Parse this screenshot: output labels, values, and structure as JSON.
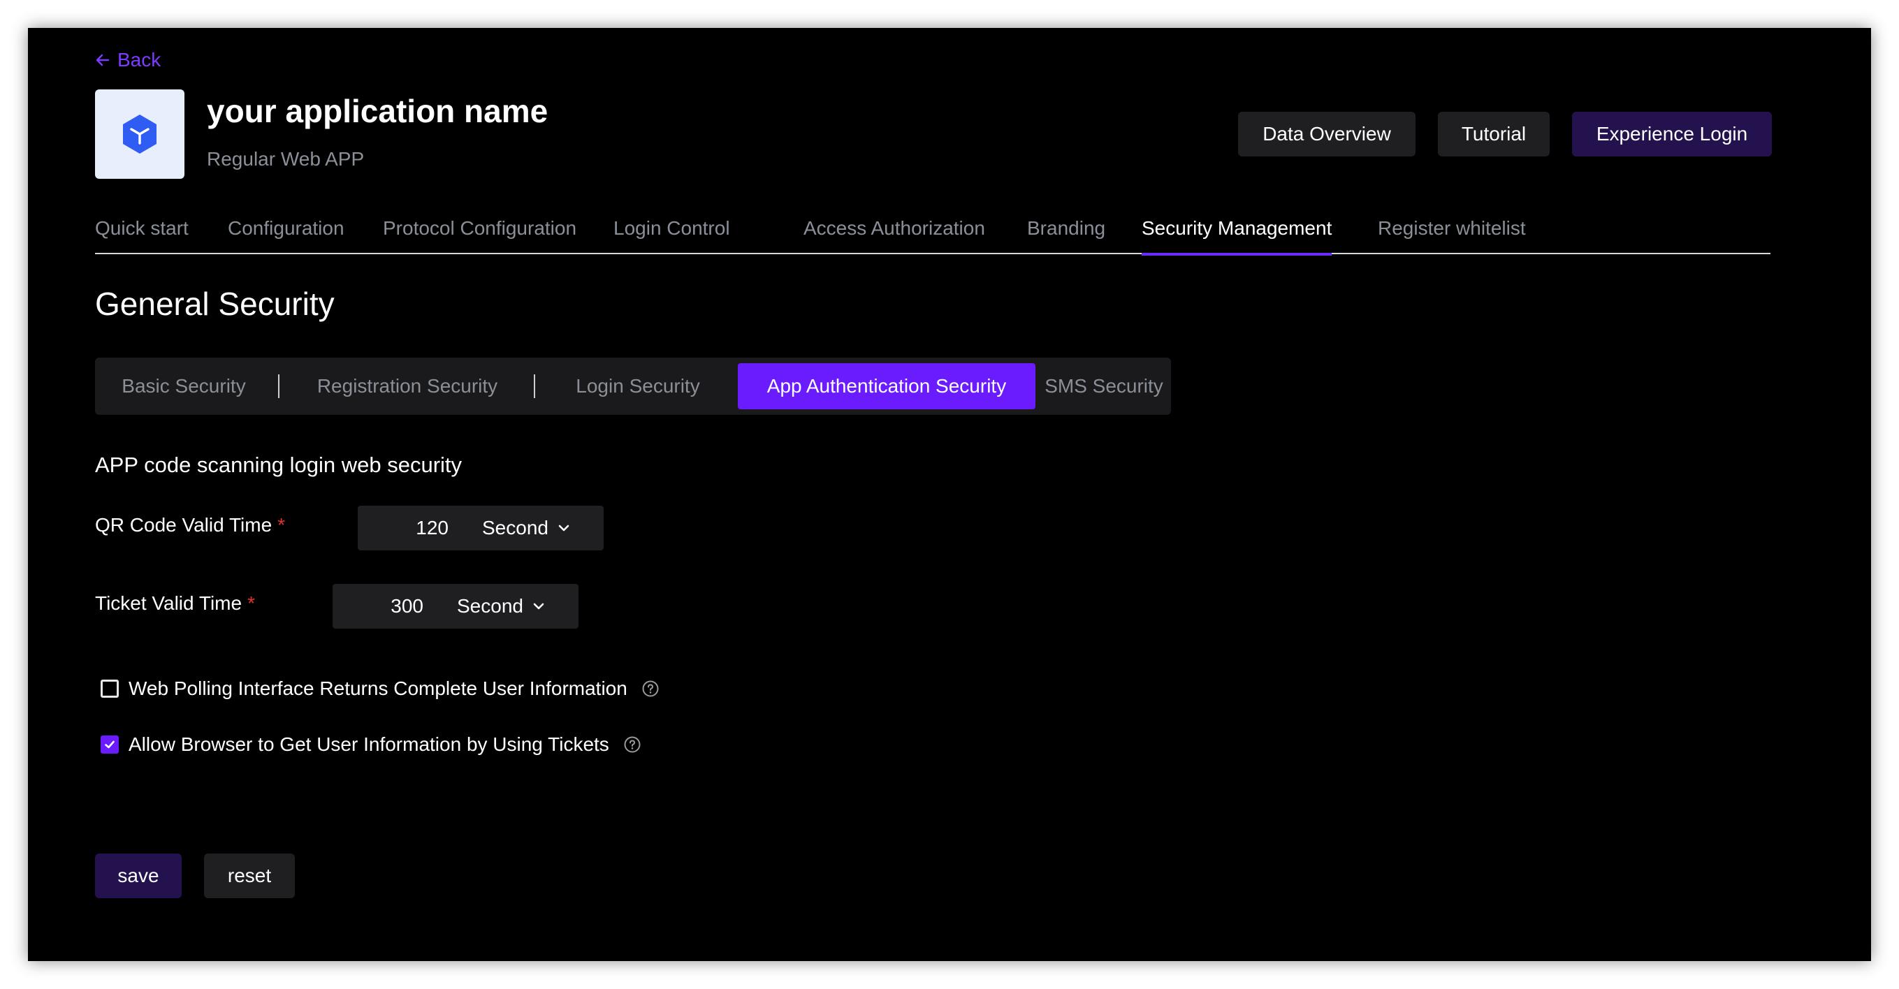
{
  "header": {
    "back_label": "Back",
    "app_name": "your application name",
    "app_type": "Regular Web APP",
    "buttons": {
      "data_overview": "Data Overview",
      "tutorial": "Tutorial",
      "experience_login": "Experience Login"
    }
  },
  "tabs": [
    {
      "label": "Quick start"
    },
    {
      "label": "Configuration"
    },
    {
      "label": "Protocol Configuration"
    },
    {
      "label": "Login Control"
    },
    {
      "label": "Access Authorization"
    },
    {
      "label": "Branding"
    },
    {
      "label": "Security Management",
      "active": true
    },
    {
      "label": "Register whitelist"
    }
  ],
  "section": {
    "title": "General Security",
    "subtabs": [
      {
        "label": "Basic Security"
      },
      {
        "label": "Registration Security"
      },
      {
        "label": "Login Security"
      },
      {
        "label": "App Authentication Security",
        "active": true
      },
      {
        "label": "SMS Security"
      }
    ]
  },
  "form": {
    "title": "APP code scanning login web security",
    "qr_valid_time": {
      "label": "QR Code Valid Time",
      "required_mark": "*",
      "value": "120",
      "unit": "Second"
    },
    "ticket_valid_time": {
      "label": "Ticket Valid Time",
      "required_mark": "*",
      "value": "300",
      "unit": "Second"
    },
    "web_polling": {
      "label": "Web Polling Interface Returns Complete User Information",
      "checked": false
    },
    "allow_browser": {
      "label": "Allow Browser to Get User Information by Using Tickets",
      "checked": true
    }
  },
  "footer": {
    "save_label": "save",
    "reset_label": "reset"
  },
  "colors": {
    "accent": "#6a1cff",
    "accent_dark": "#24124f",
    "background": "#000000",
    "muted_text": "#8a8f98",
    "required": "#e03131"
  }
}
